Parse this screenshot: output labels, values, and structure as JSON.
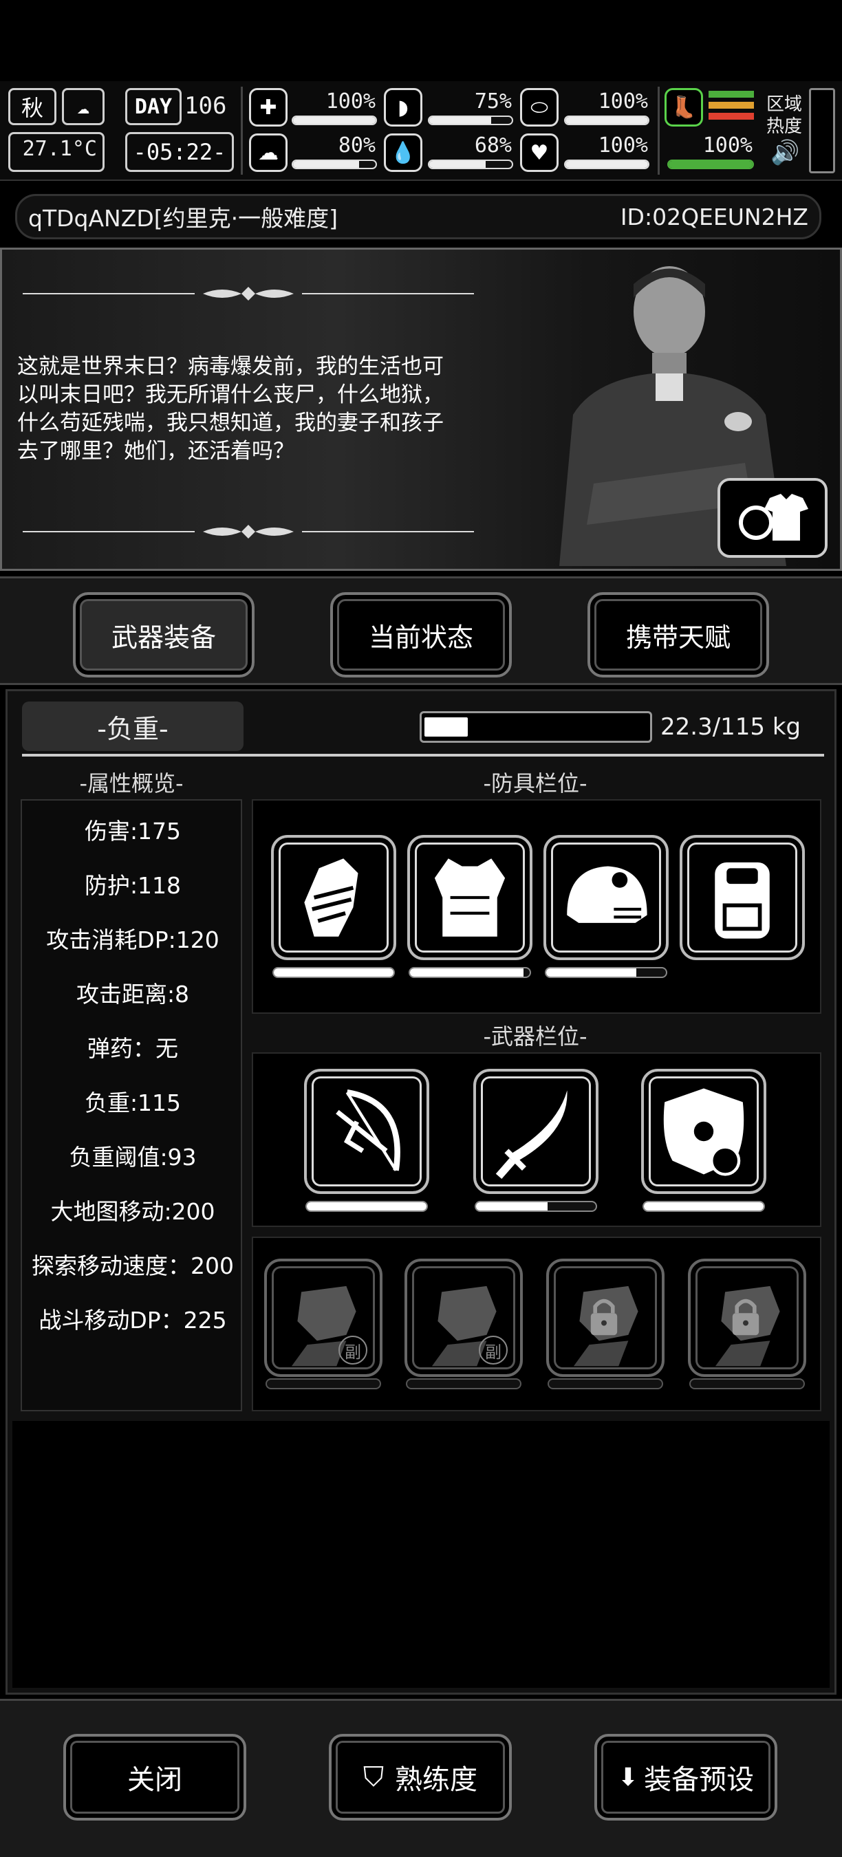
{
  "hud": {
    "season": "秋",
    "day_label": "DAY",
    "day": "106",
    "temperature": "27.1°C",
    "time": "-05:22-",
    "stats": {
      "health": {
        "value": "100%",
        "fill": 1.0
      },
      "hunger": {
        "value": "75%",
        "fill": 0.75
      },
      "stamina": {
        "value": "100%",
        "fill": 1.0
      },
      "sanity": {
        "value": "80%",
        "fill": 0.8
      },
      "thirst": {
        "value": "68%",
        "fill": 0.68
      },
      "mood": {
        "value": "100%",
        "fill": 1.0
      },
      "speed": {
        "value": "100%",
        "fill": 1.0
      }
    },
    "region_heat": "区域\n热度",
    "region_line1": "区域",
    "region_line2": "热度"
  },
  "profile": {
    "name": "qTDqANZD[约里克·一般难度]",
    "id": "ID:02QEEUN2HZ"
  },
  "story": {
    "text": "这就是世界末日？病毒爆发前，我的生活也可以叫末日吧？我无所谓什么丧尸，什么地狱，什么苟延残喘，我只想知道，我的妻子和孩子去了哪里？她们，还活着吗？"
  },
  "tabs": [
    {
      "label": "武器装备",
      "active": true
    },
    {
      "label": "当前状态",
      "active": false
    },
    {
      "label": "携带天赋",
      "active": false
    }
  ],
  "load": {
    "label": "-负重-",
    "text": "22.3/115 kg",
    "fill": 0.194
  },
  "attributes": {
    "title": "-属性概览-",
    "items": [
      "伤害:175",
      "防护:118",
      "攻击消耗DP:120",
      "攻击距离:8",
      "弹药：无",
      "负重:115",
      "负重阈值:93",
      "大地图移动:200",
      "探索移动速度：200",
      "战斗移动DP：225"
    ]
  },
  "armor": {
    "title": "-防具栏位-",
    "slots": [
      {
        "icon": "glove-icon",
        "durability": 1.0
      },
      {
        "icon": "vest-icon",
        "durability": 0.95
      },
      {
        "icon": "helmet-icon",
        "durability": 0.75
      },
      {
        "icon": "backpack-icon",
        "durability": null
      }
    ]
  },
  "weapons": {
    "title": "-武器栏位-",
    "slots": [
      {
        "icon": "crossbow-icon",
        "durability": 1.0
      },
      {
        "icon": "katana-icon",
        "durability": 0.6
      },
      {
        "icon": "shield-icon",
        "durability": 1.0
      }
    ],
    "secondary": [
      {
        "icon": "fist-icon",
        "badge": "副",
        "locked": false
      },
      {
        "icon": "fist-icon",
        "badge": "副",
        "locked": false
      },
      {
        "icon": "fist-icon",
        "badge": "",
        "locked": true
      },
      {
        "icon": "fist-icon",
        "badge": "",
        "locked": true
      }
    ]
  },
  "bottom": {
    "close": "关闭",
    "proficiency": "熟练度",
    "preset": "装备预设"
  }
}
